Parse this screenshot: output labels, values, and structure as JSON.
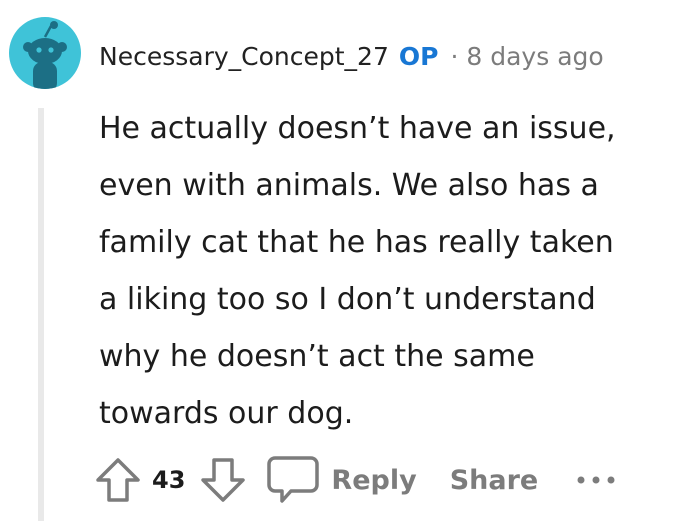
{
  "comment": {
    "author": "Necessary_Concept_27",
    "op_badge": "OP",
    "separator": "·",
    "timestamp": "8 days ago",
    "avatar_icon": "snoo-avatar-icon",
    "body_lines": [
      "He actually doesn’t have an issue,",
      "even with animals. We also has a",
      "family cat that he has really taken",
      "a liking too so I don’t understand",
      "why he doesn’t act the same",
      "towards our dog."
    ]
  },
  "actions": {
    "upvote_icon": "upvote-arrow-icon",
    "score": "43",
    "downvote_icon": "downvote-arrow-icon",
    "reply_icon": "speech-bubble-icon",
    "reply_label": "Reply",
    "share_label": "Share",
    "more_icon": "ellipsis-icon"
  },
  "colors": {
    "op_badge": "#1877d4",
    "muted_text": "#7c7c7c",
    "avatar_bg": "#3fc3d8",
    "thread_line": "#e9e9e9"
  }
}
